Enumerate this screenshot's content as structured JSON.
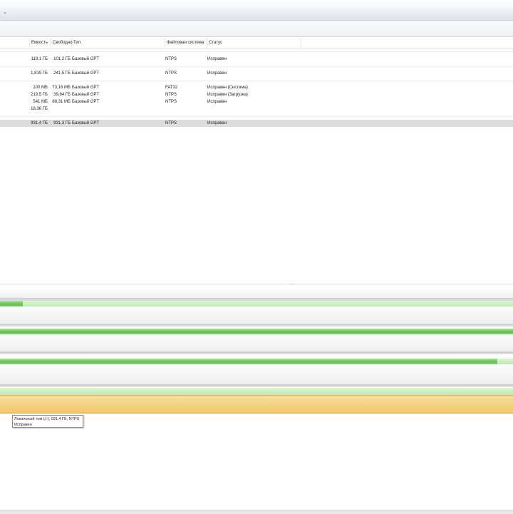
{
  "window": {
    "menu_chevron": "⌄"
  },
  "list": {
    "headers": {
      "capacity": "Емкость",
      "free": "Свободно",
      "type": "Тип",
      "filesystem": "Файловая система",
      "status": "Статус"
    },
    "rows": [
      {
        "capacity": "119,1 ГБ",
        "free": "101,2 ГБ",
        "type": "Базовый GPT",
        "filesystem": "NTPS",
        "status": "Исправен"
      },
      {
        "capacity": "1,819 ГБ",
        "free": "241,5 ГБ",
        "type": "Базовый GPT",
        "filesystem": "NTPS",
        "status": "Исправен"
      },
      {
        "capacity": "100 МБ",
        "free": "73,16 МБ",
        "type": "Базовый GPT",
        "filesystem": "FAT32",
        "status": "Исправен (Система)"
      },
      {
        "capacity": "219,5 ГБ",
        "free": "39,84 ГБ",
        "type": "Базовый GPT",
        "filesystem": "NTPS",
        "status": "Исправен (Загрузка)"
      },
      {
        "capacity": "541 МБ",
        "free": "88,31 МБ",
        "type": "Базовый GPT",
        "filesystem": "NTPS",
        "status": "Исправен"
      },
      {
        "capacity": "18,36 ГБ",
        "free": "",
        "type": "",
        "filesystem": "",
        "status": ""
      },
      {
        "capacity": "931,4 ГБ",
        "free": "931,3 ГБ",
        "type": "Базовый GPT",
        "filesystem": "NTPS",
        "status": "Исправен"
      }
    ]
  },
  "splitter": {
    "grip": "⋯"
  },
  "graphic": {
    "disk1_used_fraction": 0.045,
    "disk3_used_fraction": 0.97
  },
  "tooltip": {
    "line1": "Локальный том (J:), 931,4 ГБ, NTPS",
    "line2": "Исправен"
  },
  "colors": {
    "used_green": "#5fc24b",
    "free_green": "#bfeab4",
    "selected_volume": "#f3cf78",
    "selected_row": "#dcdcdc"
  }
}
